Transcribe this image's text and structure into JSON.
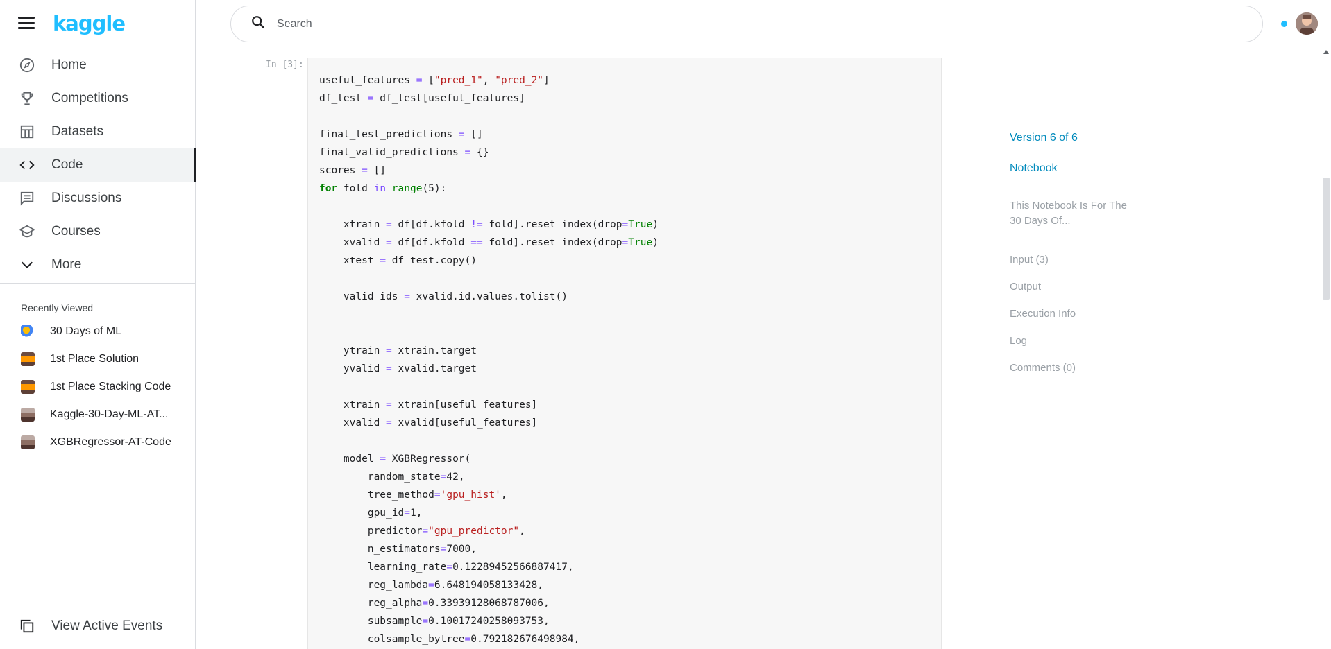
{
  "header": {
    "logo": "kaggle",
    "search_placeholder": "Search"
  },
  "nav": {
    "items": [
      {
        "label": "Home",
        "icon": "compass-icon"
      },
      {
        "label": "Competitions",
        "icon": "trophy-icon"
      },
      {
        "label": "Datasets",
        "icon": "table-icon"
      },
      {
        "label": "Code",
        "icon": "code-icon",
        "active": true
      },
      {
        "label": "Discussions",
        "icon": "comment-icon"
      },
      {
        "label": "Courses",
        "icon": "school-icon"
      },
      {
        "label": "More",
        "icon": "chevron-down-icon"
      }
    ],
    "recent_title": "Recently Viewed",
    "recent": [
      {
        "label": "30 Days of ML"
      },
      {
        "label": "1st Place Solution"
      },
      {
        "label": "1st Place Stacking Code"
      },
      {
        "label": "Kaggle-30-Day-ML-AT..."
      },
      {
        "label": "XGBRegressor-AT-Code"
      }
    ],
    "bottom_label": "View Active Events"
  },
  "cell": {
    "prompt": "In [3]:"
  },
  "toc": {
    "version": "Version 6 of 6",
    "notebook": "Notebook",
    "description": "This Notebook Is For The 30 Days Of...",
    "links": [
      "Input (3)",
      "Output",
      "Execution Info",
      "Log",
      "Comments (0)"
    ]
  },
  "colors": {
    "brand": "#20beff",
    "link": "#008abc",
    "keyword": "#008000",
    "string": "#ba2121",
    "operator": "#7c4dff"
  }
}
